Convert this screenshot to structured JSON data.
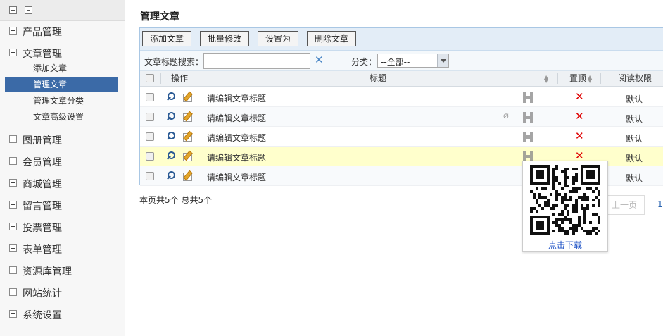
{
  "sidebar": {
    "groups_top": [
      {
        "label": "产品管理",
        "state": "collapsed"
      },
      {
        "label": "文章管理",
        "state": "expanded"
      }
    ],
    "article_items": [
      {
        "label": "添加文章",
        "active": false
      },
      {
        "label": "管理文章",
        "active": true
      },
      {
        "label": "管理文章分类",
        "active": false
      },
      {
        "label": "文章高级设置",
        "active": false
      }
    ],
    "groups_bottom": [
      {
        "label": "图册管理"
      },
      {
        "label": "会员管理"
      },
      {
        "label": "商城管理"
      },
      {
        "label": "留言管理"
      },
      {
        "label": "投票管理"
      },
      {
        "label": "表单管理"
      },
      {
        "label": "资源库管理"
      },
      {
        "label": "网站统计"
      },
      {
        "label": "系统设置"
      }
    ]
  },
  "main": {
    "title": "管理文章",
    "toolbar": {
      "add": "添加文章",
      "batch_edit": "批量修改",
      "set_as": "设置为",
      "delete": "删除文章"
    },
    "search": {
      "label": "文章标题搜索：",
      "value": "",
      "clear_glyph": "✕",
      "category_label": "分类：",
      "category_value": "--全部--"
    },
    "table": {
      "columns": [
        "操作",
        "标题",
        "置顶",
        "阅读权限"
      ],
      "rows": [
        {
          "title": "请编辑文章标题",
          "attachment": false,
          "pinned_glyph": "✕",
          "permission": "默认"
        },
        {
          "title": "请编辑文章标题",
          "attachment": true,
          "pinned_glyph": "✕",
          "permission": "默认"
        },
        {
          "title": "请编辑文章标题",
          "attachment": false,
          "pinned_glyph": "✕",
          "permission": "默认"
        },
        {
          "title": "请编辑文章标题",
          "attachment": false,
          "pinned_glyph": "✕",
          "permission": "默认"
        },
        {
          "title": "请编辑文章标题",
          "attachment": false,
          "pinned_glyph": "",
          "permission": "默认"
        }
      ]
    },
    "pager": {
      "summary": "本页共5个 总共5个",
      "prev": "上一页",
      "page": "1"
    },
    "qr_popup": {
      "download": "点击下载"
    }
  },
  "colors": {
    "sidebar_active": "#3b6aa7",
    "panel_border": "#a9c7e4",
    "toolbar_bg": "#e3edf7",
    "pinned_x": "#e00000",
    "highlight_row": "#ffffcc",
    "link": "#1a4fc4"
  },
  "icons": {
    "view": "magnifier-icon",
    "edit": "pencil-icon",
    "qr": "qr-code-icon",
    "attachment": "paperclip-icon",
    "toggle_collapsed": "plus-box-icon",
    "toggle_expanded": "minus-box-icon"
  }
}
